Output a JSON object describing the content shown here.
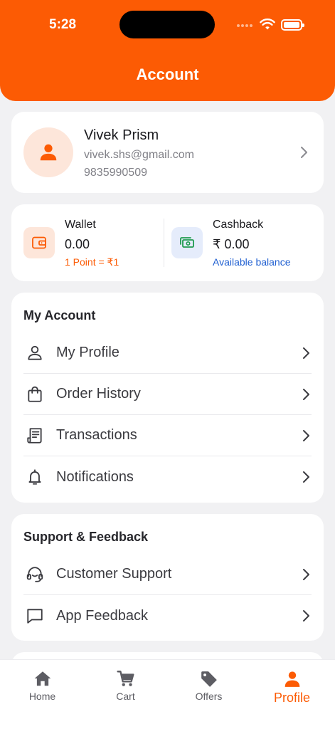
{
  "status_bar": {
    "time": "5:28"
  },
  "header": {
    "title": "Account"
  },
  "profile": {
    "name": "Vivek Prism",
    "email": "vivek.shs@gmail.com",
    "phone": "9835990509"
  },
  "wallet": {
    "label": "Wallet",
    "value": "0.00",
    "note": "1 Point = ₹1"
  },
  "cashback": {
    "label": "Cashback",
    "value": "₹ 0.00",
    "note": "Available balance"
  },
  "my_account": {
    "title": "My Account",
    "items": [
      {
        "label": "My Profile",
        "icon": "person-icon"
      },
      {
        "label": "Order History",
        "icon": "shopping-bag-icon"
      },
      {
        "label": "Transactions",
        "icon": "receipt-icon"
      },
      {
        "label": "Notifications",
        "icon": "bell-icon"
      }
    ]
  },
  "support": {
    "title": "Support & Feedback",
    "items": [
      {
        "label": "Customer Support",
        "icon": "headset-icon"
      },
      {
        "label": "App Feedback",
        "icon": "chat-bubble-icon"
      }
    ]
  },
  "bottom_nav": {
    "items": [
      {
        "label": "Home",
        "icon": "home-icon"
      },
      {
        "label": "Cart",
        "icon": "cart-icon"
      },
      {
        "label": "Offers",
        "icon": "tag-icon"
      },
      {
        "label": "Profile",
        "icon": "person-icon",
        "active": true
      }
    ]
  },
  "colors": {
    "brand": "#fc5b04",
    "link_blue": "#1f5fd1",
    "background": "#f1f1f3"
  }
}
